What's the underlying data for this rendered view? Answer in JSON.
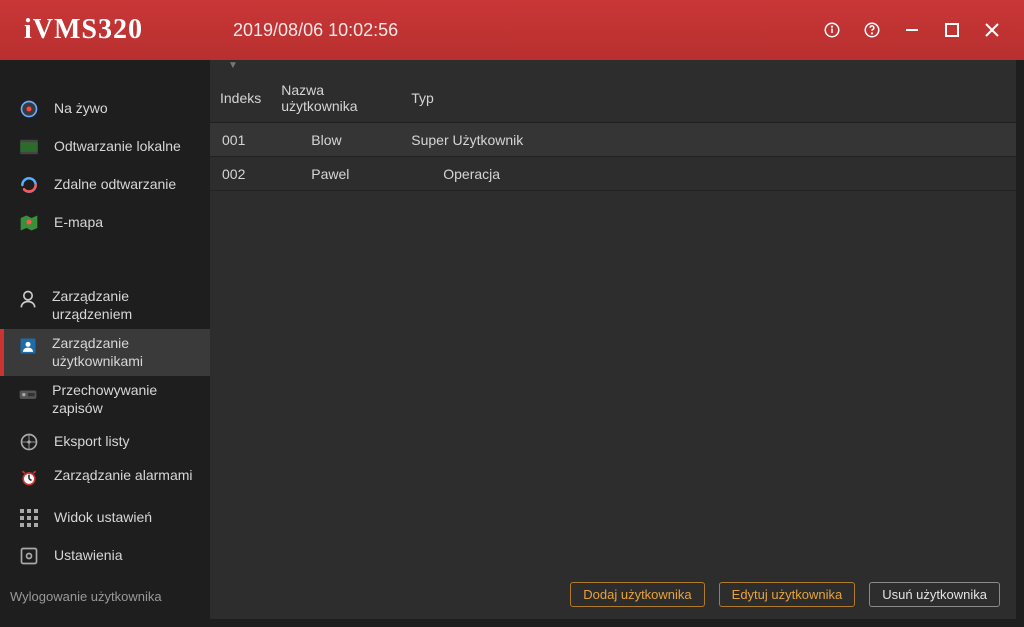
{
  "titlebar": {
    "app_name": "iVMS320",
    "timestamp": "2019/08/06 10:02:56"
  },
  "sidebar": {
    "groupA": [
      {
        "label": "Na żywo"
      },
      {
        "label": "Odtwarzanie lokalne"
      },
      {
        "label": "Zdalne odtwarzanie"
      },
      {
        "label": "E-mapa"
      }
    ],
    "groupB": [
      {
        "label": "Zarządzanie urządzeniem"
      },
      {
        "label": "Zarządzanie użytkownikami"
      },
      {
        "label": "Przechowywanie zapisów"
      },
      {
        "label": "Eksport listy"
      },
      {
        "label": "Zarządzanie alarmami"
      },
      {
        "label": "Widok ustawień"
      },
      {
        "label": "Ustawienia"
      }
    ],
    "logout": "Wylogowanie użytkownika"
  },
  "table": {
    "headers": {
      "index": "Indeks",
      "name": "Nazwa użytkownika",
      "type": "Typ"
    },
    "rows": [
      {
        "index": "001",
        "name": "Blow",
        "type": "Super Użytkownik"
      },
      {
        "index": "002",
        "name": "Pawel",
        "type": "Operacja"
      }
    ]
  },
  "footer": {
    "add": "Dodaj użytkownika",
    "edit": "Edytuj użytkownika",
    "delete": "Usuń użytkownika"
  }
}
